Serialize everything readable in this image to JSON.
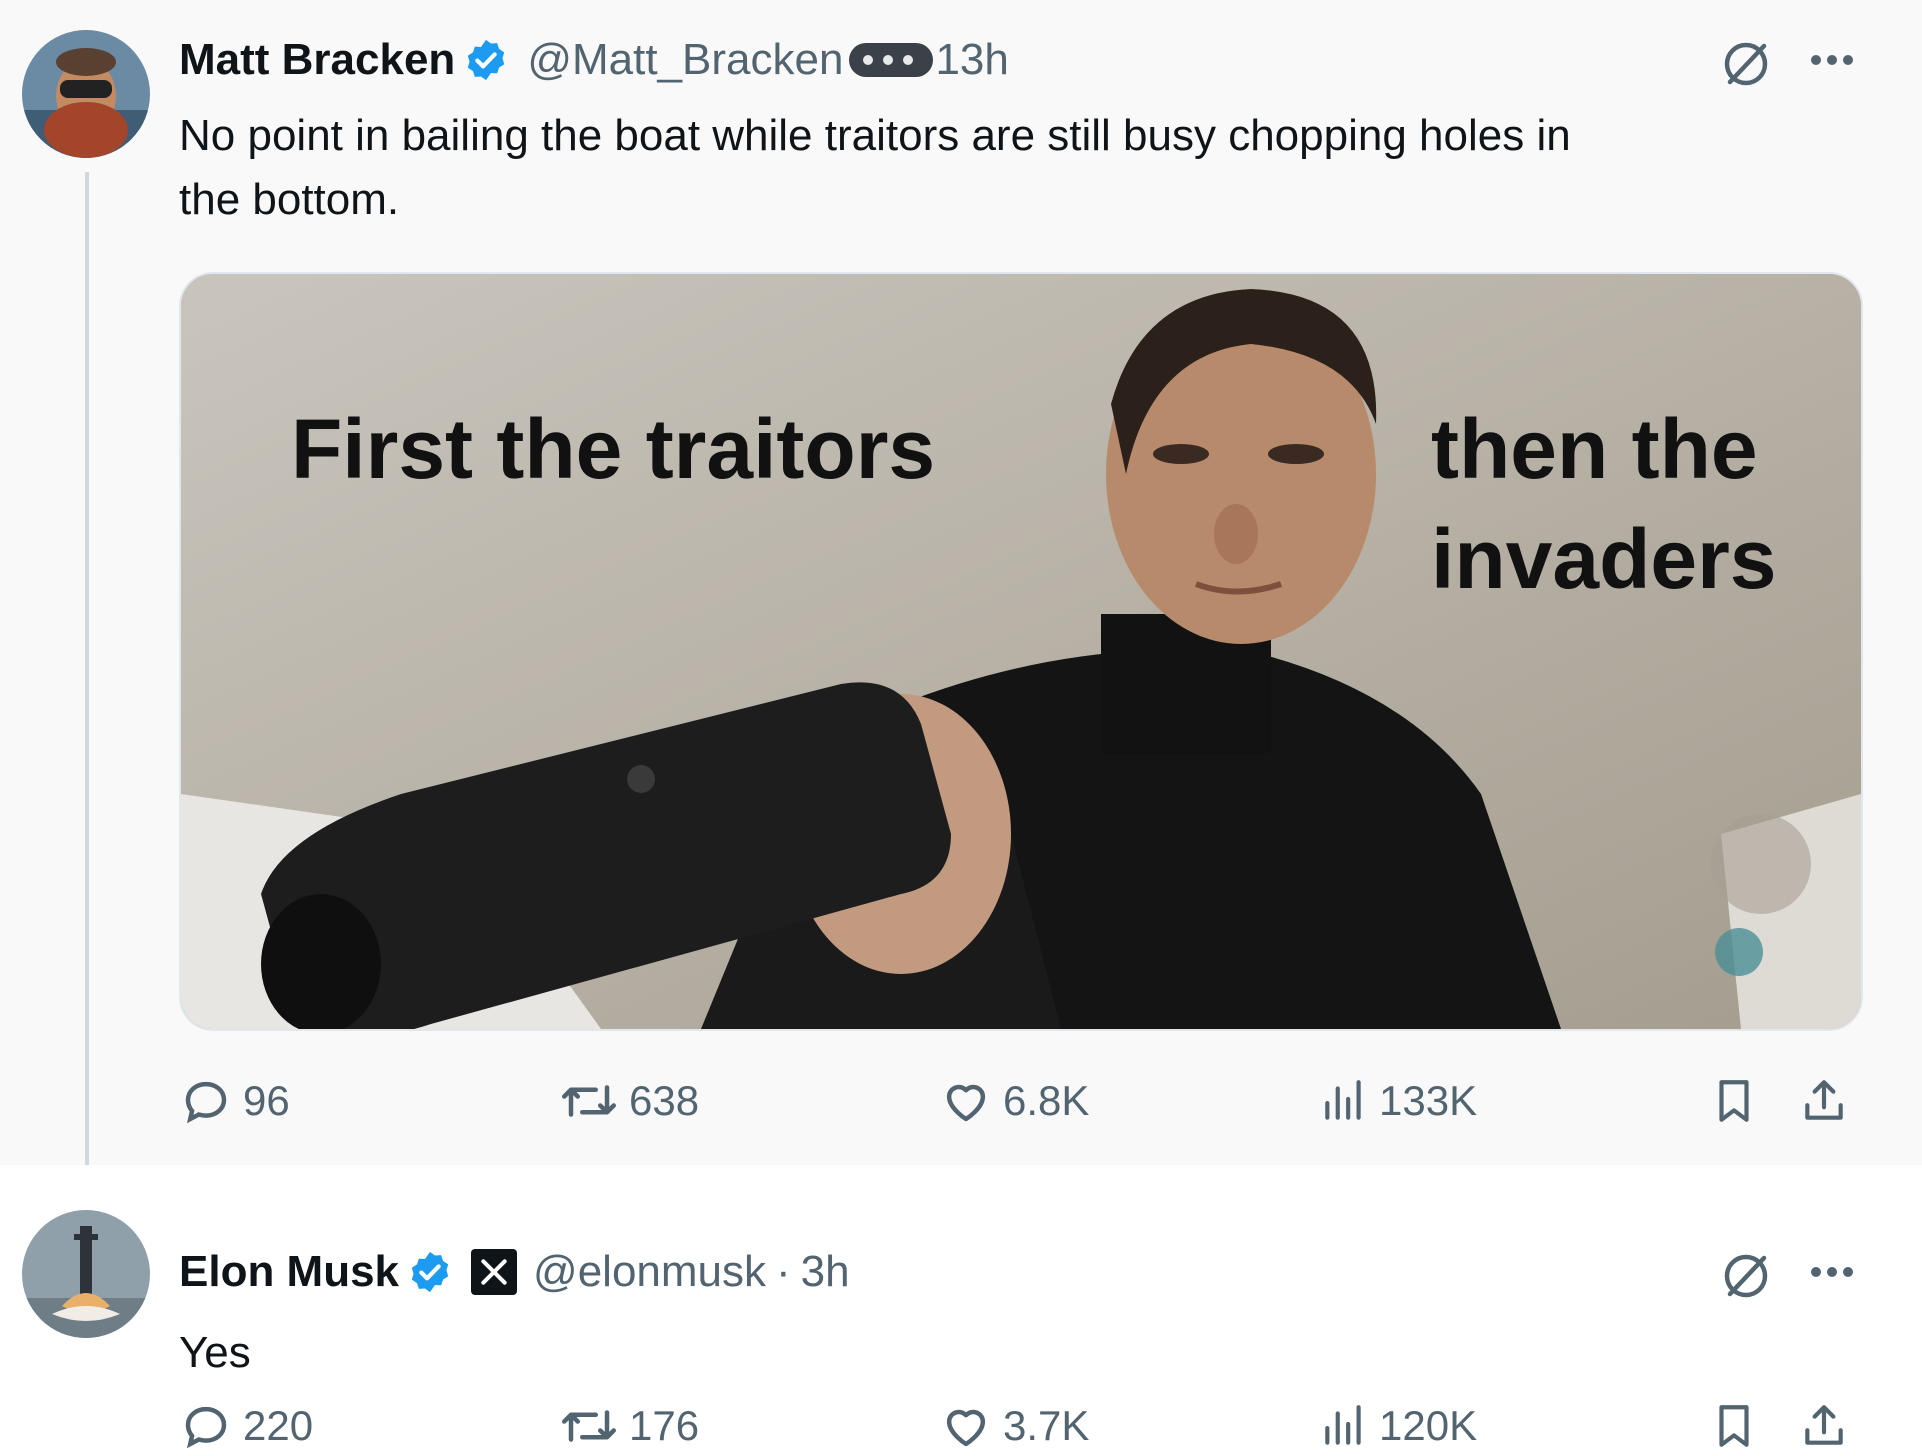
{
  "tweets": [
    {
      "author_name": "Matt Bracken",
      "handle": "@Matt_Bracken",
      "time": "13h",
      "text_line1": "No point in bailing the boat while traitors are still busy chopping holes in",
      "text_line2": "the bottom.",
      "media": {
        "caption_left": "First the traitors",
        "caption_right_line1": "then the",
        "caption_right_line2": "invaders"
      },
      "stats": {
        "replies": "96",
        "reposts": "638",
        "likes": "6.8K",
        "views": "133K"
      }
    },
    {
      "author_name": "Elon Musk",
      "handle": "@elonmusk",
      "separator": "·",
      "time": "3h",
      "text": "Yes",
      "stats": {
        "replies": "220",
        "reposts": "176",
        "likes": "3.7K",
        "views": "120K"
      }
    }
  ],
  "icons": [
    "verified-badge-icon",
    "x-logo-icon",
    "grok-icon",
    "more-icon",
    "reply-icon",
    "repost-icon",
    "like-icon",
    "views-icon",
    "bookmark-icon",
    "share-icon"
  ],
  "colors": {
    "verified": "#1d9bf0",
    "secondary_text": "#536471",
    "primary_text": "#0f1419"
  }
}
